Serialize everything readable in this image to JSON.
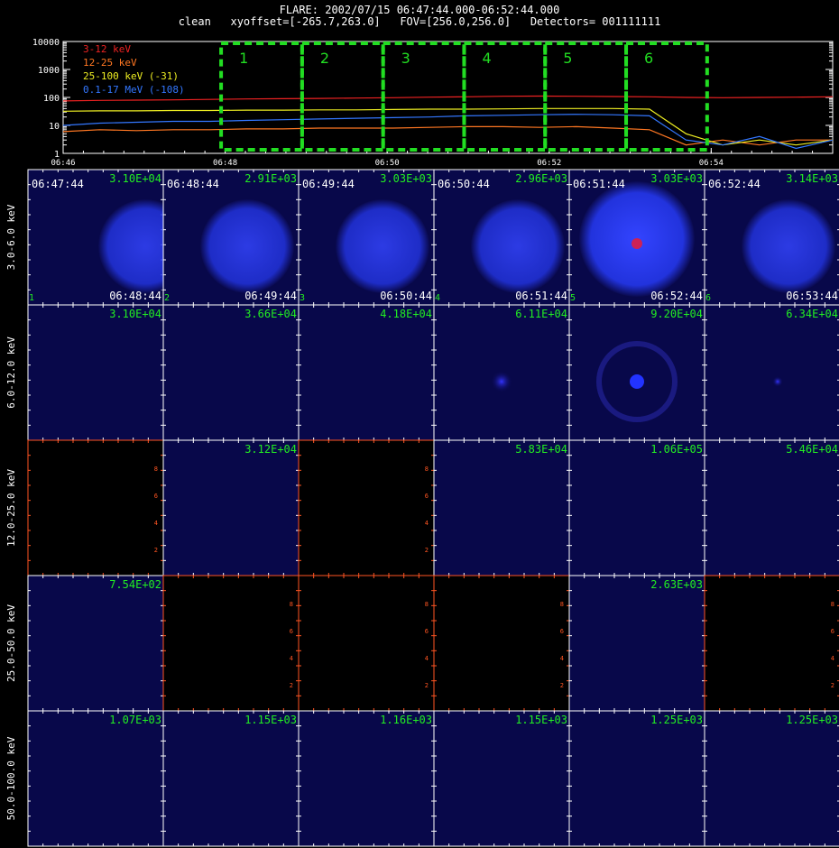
{
  "header": {
    "title": "FLARE: 2002/07/15 06:47:44.000-06:52:44.000",
    "subtitle": "clean   xyoffset=[-265.7,263.0]   FOV=[256.0,256.0]   Detectors= 001111111"
  },
  "colors": {
    "background": "#000000",
    "frame": "#ffffff",
    "box": "#22dd22",
    "empty_frame": "#ff5522",
    "band_3_12": "#ee2222",
    "band_12_25": "#ff7722",
    "band_25_100": "#eeee22",
    "band_01_17": "#3377ff",
    "label_green": "#22ee22"
  },
  "chart_data": {
    "type": "line",
    "x": [
      "06:46",
      "06:46:30",
      "06:47",
      "06:47:30",
      "06:48",
      "06:48:30",
      "06:49",
      "06:49:30",
      "06:50",
      "06:50:30",
      "06:51",
      "06:51:30",
      "06:52",
      "06:52:30",
      "06:53",
      "06:53:30",
      "06:54",
      "06:54:20",
      "06:54:40",
      "06:55",
      "06:55:20",
      "06:55:40"
    ],
    "xticks": [
      "06:46",
      "06:48",
      "06:50",
      "06:52",
      "06:54"
    ],
    "yscale": "log",
    "ylim": [
      1,
      10000
    ],
    "yticks": [
      "1",
      "10",
      "100",
      "1000",
      "10000"
    ],
    "series": [
      {
        "name": "3-12 keV",
        "color": "#ee2222",
        "values": [
          75,
          78,
          80,
          82,
          85,
          88,
          90,
          92,
          95,
          98,
          102,
          105,
          110,
          112,
          110,
          108,
          105,
          100,
          98,
          100,
          102,
          105
        ]
      },
      {
        "name": "12-25 keV",
        "color": "#ff7722",
        "values": [
          6,
          7,
          6.5,
          7,
          7,
          7.5,
          7.5,
          8,
          8,
          8,
          8.5,
          9,
          9,
          8.5,
          9,
          8,
          7,
          2,
          3,
          2,
          3,
          3
        ]
      },
      {
        "name": "25-100 keV (-31)",
        "color": "#eeee22",
        "values": [
          32,
          33,
          33,
          34,
          34,
          35,
          35,
          36,
          36,
          37,
          38,
          38,
          39,
          40,
          40,
          40,
          38,
          5,
          2,
          3,
          2,
          3
        ]
      },
      {
        "name": "0.1-17 MeV (-108)",
        "color": "#3377ff",
        "values": [
          10,
          12,
          13,
          14,
          14,
          15,
          16,
          17,
          18,
          19,
          20,
          22,
          23,
          24,
          25,
          24,
          22,
          3,
          2,
          4,
          1.5,
          3
        ]
      }
    ],
    "boxes": [
      "1",
      "2",
      "3",
      "4",
      "5",
      "6"
    ]
  },
  "grid": {
    "rows": [
      {
        "label": "3.0-6.0 keV",
        "maxes": [
          "3.10E+04",
          "2.91E+03",
          "3.03E+03",
          "2.96E+03",
          "3.03E+03",
          "3.14E+03"
        ],
        "start_times": [
          "06:47:44",
          "06:48:44",
          "06:49:44",
          "06:50:44",
          "06:51:44",
          "06:52:44"
        ],
        "end_times": [
          "06:48:44",
          "06:49:44",
          "06:50:44",
          "06:51:44",
          "06:52:44",
          "06:53:44"
        ],
        "indices": [
          "1",
          "2",
          "3",
          "4",
          "5",
          "6"
        ],
        "empty": [
          false,
          false,
          false,
          false,
          false,
          false
        ]
      },
      {
        "label": "6.0-12.0 keV",
        "maxes": [
          "3.10E+04",
          "3.66E+04",
          "4.18E+04",
          "6.11E+04",
          "9.20E+04",
          "6.34E+04"
        ],
        "empty": [
          false,
          false,
          false,
          false,
          false,
          false
        ]
      },
      {
        "label": "12.0-25.0 keV",
        "maxes": [
          "",
          "3.12E+04",
          "",
          "5.83E+04",
          "1.06E+05",
          "5.46E+04"
        ],
        "empty": [
          true,
          false,
          true,
          false,
          false,
          false
        ]
      },
      {
        "label": "25.0-50.0 keV",
        "maxes": [
          "7.54E+02",
          "",
          "",
          "",
          "2.63E+03",
          ""
        ],
        "empty": [
          false,
          true,
          true,
          true,
          false,
          true
        ]
      },
      {
        "label": "50.0-100.0 keV",
        "maxes": [
          "1.07E+03",
          "1.15E+03",
          "1.16E+03",
          "1.15E+03",
          "1.25E+03",
          "1.25E+03"
        ],
        "empty": [
          false,
          false,
          false,
          false,
          false,
          false
        ]
      }
    ],
    "empty_axis_ticks": [
      "2",
      "4",
      "6",
      "8"
    ]
  }
}
